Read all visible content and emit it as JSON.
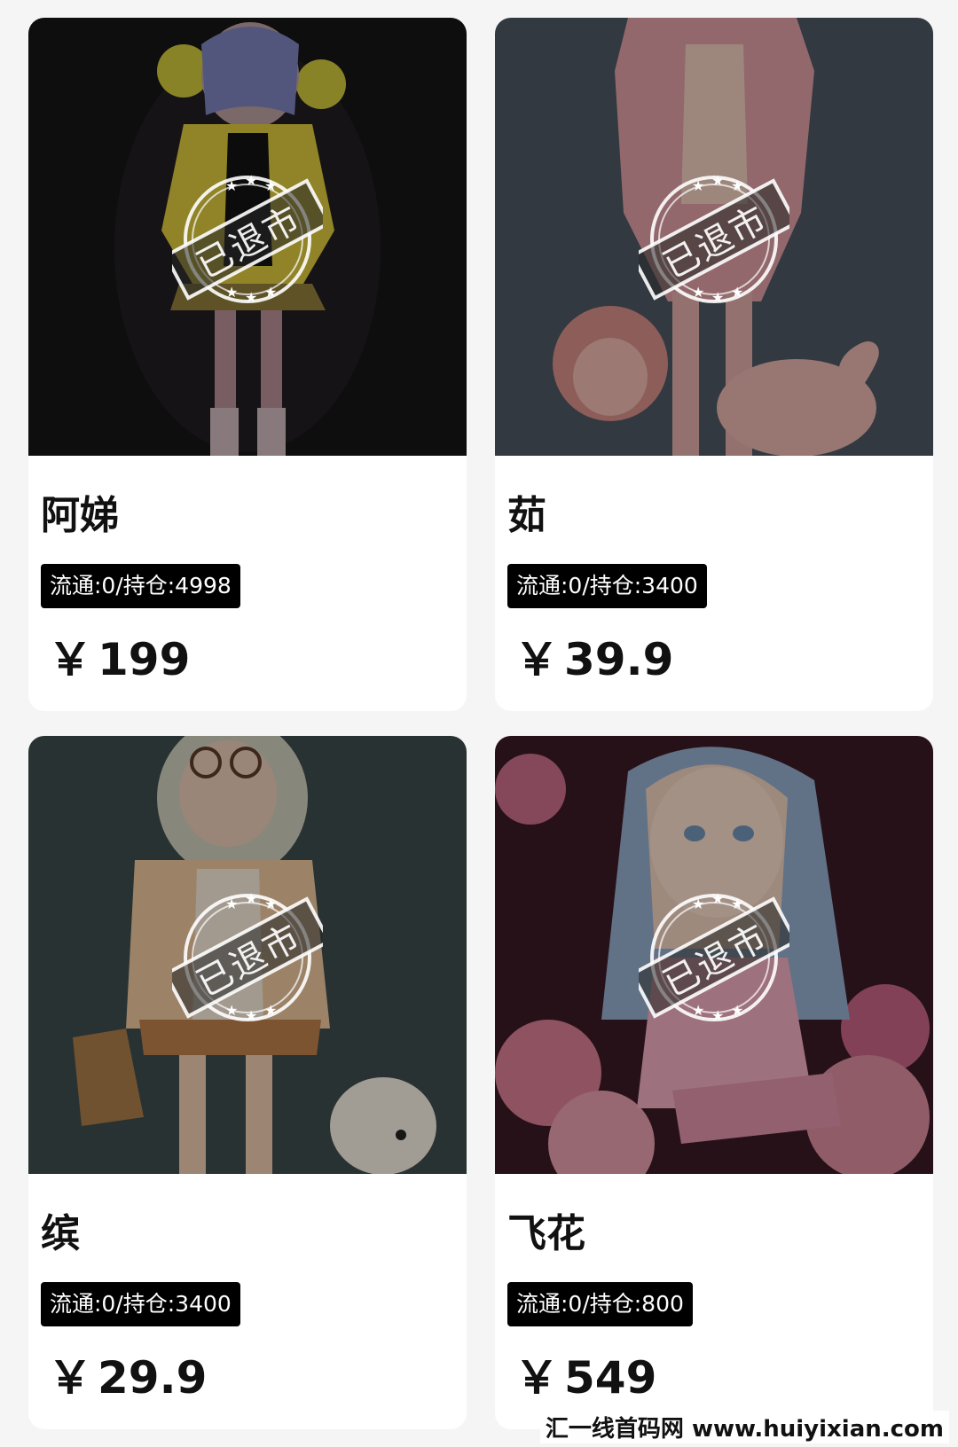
{
  "cards": [
    {
      "name": "阿娣",
      "stamp": "已退市",
      "tag": "流通:0/持仓:4998",
      "currency": "￥",
      "price": "199"
    },
    {
      "name": "茹",
      "stamp": "已退市",
      "tag": "流通:0/持仓:3400",
      "currency": "￥",
      "price": "39.9"
    },
    {
      "name": "缤",
      "stamp": "已退市",
      "tag": "流通:0/持仓:3400",
      "currency": "￥",
      "price": "29.9"
    },
    {
      "name": "飞花",
      "stamp": "已退市",
      "tag": "流通:0/持仓:800",
      "currency": "￥",
      "price": "549"
    }
  ],
  "watermark": "汇一线首码网 www.huiyixian.com",
  "colors": {
    "tag_bg": "#000000",
    "card_bg": "#ffffff",
    "page_bg": "#f5f5f5"
  }
}
